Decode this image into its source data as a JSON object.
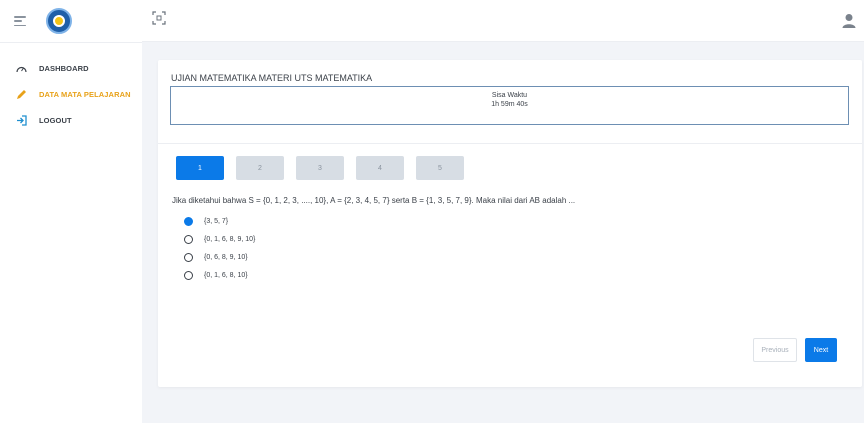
{
  "sidebar": {
    "items": [
      {
        "label": "DASHBOARD",
        "icon": "gauge-icon",
        "active": false
      },
      {
        "label": "DATA MATA PELAJARAN",
        "icon": "pencil-icon",
        "active": true
      },
      {
        "label": "LOGOUT",
        "icon": "logout-icon",
        "active": false
      }
    ]
  },
  "exam": {
    "title": "UJIAN MATEMATIKA MATERI UTS MATEMATIKA",
    "timer_label": "Sisa Waktu",
    "timer_value": "1h 59m 40s"
  },
  "question_nav": {
    "buttons": [
      "1",
      "2",
      "3",
      "4",
      "5"
    ],
    "active_index": 0
  },
  "question": {
    "text": "Jika diketahui bahwa S = {0, 1, 2, 3, ...., 10}, A = {2, 3, 4, 5, 7} serta B = {1, 3, 5, 7, 9}. Maka nilai dari AB adalah ...",
    "options": [
      "{3, 5, 7}",
      "{0, 1, 6, 8, 9, 10}",
      "{0, 6, 8, 9, 10}",
      "{0, 1, 6, 8, 10}"
    ],
    "selected_index": 0
  },
  "pagination": {
    "previous_label": "Previous",
    "next_label": "Next"
  },
  "colors": {
    "accent": "#0b7ae8",
    "active_nav": "#e8a21a",
    "timer_border": "#6d8fb3"
  }
}
